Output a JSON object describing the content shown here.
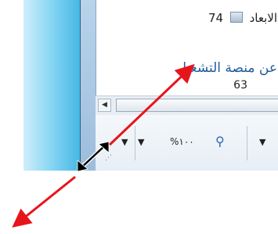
{
  "content": {
    "size_label": "الابعاد",
    "size_value": "74",
    "description": "عن منصة التشغيل",
    "partial_number": "63"
  },
  "statusbar": {
    "zoom_text": "%١٠٠",
    "zoom_icon": "zoom-magnifier-icon",
    "dropdown_glyph": "▼",
    "scroll_left_glyph": "◀",
    "grip_glyph": "⋰"
  },
  "colors": {
    "annotation_arrow": "#e8141b",
    "resize_arrow": "#000000",
    "link_text": "#1f5a9c"
  }
}
